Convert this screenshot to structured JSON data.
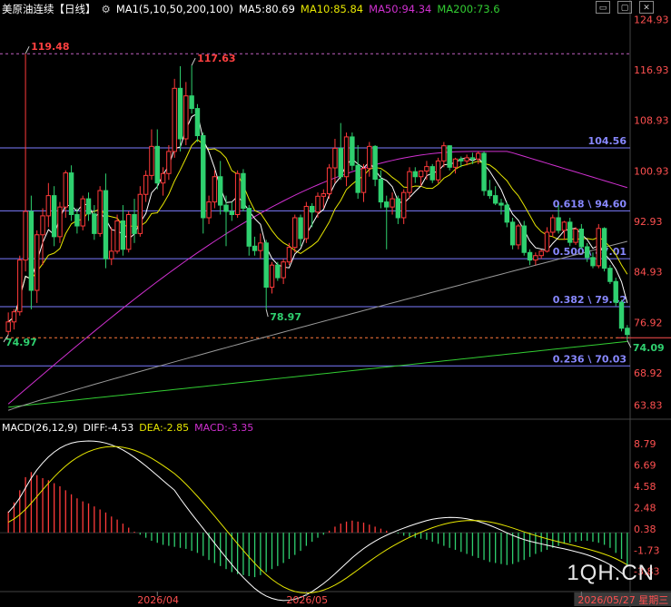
{
  "header": {
    "title": "美原油连续",
    "period": "【日线】",
    "ma_main": "MA1(5,10,50,200,100)",
    "ma5": "MA5:80.69",
    "ma10": "MA10:85.84",
    "ma50": "MA50:94.34",
    "ma200": "MA200:73.6"
  },
  "macd_header": {
    "params": "MACD(26,12,9)",
    "diff": "DIFF:-4.53",
    "dea": "DEA:-2.85",
    "macd": "MACD:-3.35"
  },
  "colors": {
    "up": "#ff3a3a",
    "down": "#2fd06f",
    "ma5": "#ffffff",
    "ma10": "#e6e600",
    "ma50": "#d030d0",
    "ma200": "#32cd32",
    "ma100": "#9a9a9a",
    "fib": "#7b7bff",
    "dashed": "#ff7a3c"
  },
  "watermark": "1QH.CN",
  "chart_data": {
    "type": "candlestick",
    "price_axis": {
      "min": 62.6,
      "max": 125.4,
      "ticks": [
        "124.93",
        "116.93",
        "108.93",
        "100.93",
        "92.93",
        "84.93",
        "76.92",
        "68.92",
        "63.83"
      ]
    },
    "fib_levels": [
      {
        "value": 104.56,
        "label": "104.56"
      },
      {
        "value": 94.6,
        "label": "0.618 \\ 94.60"
      },
      {
        "value": 87.01,
        "label": "0.500 \\ 87.01"
      },
      {
        "value": 79.42,
        "label": "0.382 \\ 79.42"
      },
      {
        "value": 70.03,
        "label": "0.236 \\ 70.03"
      }
    ],
    "dashed_levels": [
      {
        "value": 119.48
      },
      {
        "value": 74.5
      }
    ],
    "annotations": [
      {
        "label": "119.48",
        "value": 119.48,
        "index": 3,
        "color": "#ff4040"
      },
      {
        "label": "117.63",
        "value": 117.63,
        "index": 32,
        "color": "#ff4040"
      },
      {
        "label": "78.97",
        "value": 78.97,
        "index": 45,
        "color": "#2fd06f"
      },
      {
        "label": "74.97",
        "value": 74.97,
        "index": 0,
        "color": "#2fd06f"
      },
      {
        "label": "74.09",
        "value": 74.09,
        "index": 108,
        "color": "#2fd06f"
      }
    ],
    "candles": [
      [
        75.5,
        78.5,
        74.97,
        77.0
      ],
      [
        77.0,
        79.0,
        75.8,
        78.6
      ],
      [
        78.6,
        87.5,
        78.0,
        86.8
      ],
      [
        86.8,
        119.48,
        85.0,
        94.5
      ],
      [
        94.5,
        97.0,
        79.0,
        82.0
      ],
      [
        82.0,
        91.5,
        80.0,
        90.8
      ],
      [
        90.8,
        95.0,
        86.0,
        93.8
      ],
      [
        93.8,
        99.0,
        92.0,
        97.0
      ],
      [
        97.0,
        98.5,
        89.0,
        90.5
      ],
      [
        90.5,
        96.0,
        89.5,
        95.2
      ],
      [
        95.2,
        101.0,
        93.5,
        100.6
      ],
      [
        100.6,
        101.8,
        93.0,
        94.0
      ],
      [
        94.0,
        95.0,
        91.0,
        92.2
      ],
      [
        92.2,
        97.0,
        91.5,
        96.5
      ],
      [
        96.5,
        97.5,
        93.0,
        94.1
      ],
      [
        94.1,
        95.5,
        90.0,
        91.0
      ],
      [
        91.0,
        98.5,
        90.5,
        97.8
      ],
      [
        97.8,
        100.5,
        85.5,
        87.0
      ],
      [
        87.0,
        92.0,
        86.0,
        88.2
      ],
      [
        88.2,
        94.0,
        87.8,
        93.0
      ],
      [
        93.0,
        95.5,
        87.5,
        88.5
      ],
      [
        88.5,
        94.5,
        88.0,
        94.0
      ],
      [
        94.0,
        96.5,
        89.5,
        91.0
      ],
      [
        91.0,
        98.5,
        90.5,
        97.2
      ],
      [
        97.2,
        101.0,
        96.0,
        100.2
      ],
      [
        100.2,
        107.5,
        99.5,
        104.8
      ],
      [
        104.8,
        107.5,
        98.0,
        99.0
      ],
      [
        99.0,
        101.5,
        97.0,
        100.5
      ],
      [
        100.5,
        105.0,
        99.5,
        104.0
      ],
      [
        104.0,
        115.5,
        103.0,
        114.0
      ],
      [
        114.0,
        117.5,
        104.0,
        106.0
      ],
      [
        106.0,
        115.0,
        105.0,
        112.8
      ],
      [
        112.8,
        117.63,
        110.0,
        110.8
      ],
      [
        110.8,
        111.5,
        105.5,
        106.5
      ],
      [
        106.5,
        107.0,
        91.0,
        93.5
      ],
      [
        93.5,
        97.0,
        92.5,
        96.0
      ],
      [
        96.0,
        101.0,
        95.0,
        100.0
      ],
      [
        100.0,
        102.5,
        94.0,
        95.5
      ],
      [
        95.5,
        97.0,
        89.0,
        94.5
      ],
      [
        94.5,
        96.0,
        93.0,
        94.0
      ],
      [
        94.0,
        101.0,
        93.5,
        100.5
      ],
      [
        100.5,
        101.2,
        94.5,
        95.0
      ],
      [
        95.0,
        95.5,
        87.5,
        89.0
      ],
      [
        89.0,
        90.5,
        87.5,
        88.3
      ],
      [
        88.3,
        91.0,
        87.0,
        89.5
      ],
      [
        89.5,
        90.0,
        78.97,
        82.5
      ],
      [
        82.5,
        86.5,
        81.5,
        86.0
      ],
      [
        86.0,
        86.5,
        83.5,
        84.0
      ],
      [
        84.0,
        87.0,
        83.0,
        86.5
      ],
      [
        86.5,
        89.5,
        86.0,
        88.8
      ],
      [
        88.8,
        94.0,
        88.0,
        93.5
      ],
      [
        93.5,
        94.0,
        89.0,
        90.2
      ],
      [
        90.2,
        96.0,
        89.5,
        95.3
      ],
      [
        95.3,
        95.8,
        92.0,
        94.4
      ],
      [
        94.4,
        97.5,
        93.5,
        96.9
      ],
      [
        96.9,
        98.0,
        95.0,
        97.3
      ],
      [
        97.3,
        102.0,
        96.5,
        101.4
      ],
      [
        101.4,
        106.0,
        99.0,
        104.5
      ],
      [
        104.5,
        108.5,
        99.5,
        100.0
      ],
      [
        100.0,
        107.0,
        98.5,
        106.3
      ],
      [
        106.3,
        107.0,
        101.0,
        101.8
      ],
      [
        101.8,
        105.0,
        96.5,
        97.5
      ],
      [
        97.5,
        102.0,
        96.0,
        101.3
      ],
      [
        101.3,
        105.5,
        100.0,
        104.8
      ],
      [
        104.8,
        105.0,
        98.5,
        99.6
      ],
      [
        99.6,
        101.0,
        95.0,
        96.0
      ],
      [
        96.0,
        97.0,
        88.5,
        95.2
      ],
      [
        95.2,
        97.5,
        94.0,
        96.5
      ],
      [
        96.5,
        97.0,
        92.5,
        93.5
      ],
      [
        93.5,
        98.0,
        92.5,
        97.5
      ],
      [
        97.5,
        101.5,
        96.5,
        100.8
      ],
      [
        100.8,
        101.5,
        99.0,
        100.0
      ],
      [
        100.0,
        101.0,
        98.5,
        100.9
      ],
      [
        100.9,
        102.5,
        99.5,
        101.6
      ],
      [
        101.6,
        102.0,
        99.0,
        99.5
      ],
      [
        99.5,
        103.0,
        99.0,
        102.5
      ],
      [
        102.5,
        105.5,
        101.5,
        104.9
      ],
      [
        104.9,
        105.0,
        101.0,
        101.5
      ],
      [
        101.5,
        103.0,
        100.5,
        102.8
      ],
      [
        102.8,
        103.2,
        101.5,
        102.5
      ],
      [
        102.5,
        103.5,
        101.8,
        103.0
      ],
      [
        103.0,
        103.8,
        102.0,
        102.8
      ],
      [
        102.8,
        104.0,
        102.0,
        103.7
      ],
      [
        103.7,
        104.0,
        97.0,
        97.8
      ],
      [
        97.8,
        99.5,
        96.5,
        97.0
      ],
      [
        97.0,
        98.5,
        95.5,
        95.8
      ],
      [
        95.8,
        96.5,
        94.0,
        95.5
      ],
      [
        95.5,
        96.0,
        92.0,
        92.8
      ],
      [
        92.8,
        93.5,
        88.5,
        89.2
      ],
      [
        89.2,
        92.5,
        88.5,
        92.2
      ],
      [
        92.2,
        93.0,
        87.5,
        88.0
      ],
      [
        88.0,
        88.5,
        86.0,
        86.8
      ],
      [
        86.8,
        88.0,
        86.0,
        87.5
      ],
      [
        87.5,
        88.5,
        87.0,
        88.2
      ],
      [
        88.2,
        92.0,
        88.0,
        91.2
      ],
      [
        91.2,
        94.0,
        90.5,
        93.5
      ],
      [
        93.5,
        95.5,
        91.0,
        91.5
      ],
      [
        91.5,
        93.0,
        90.0,
        92.8
      ],
      [
        92.8,
        93.5,
        89.0,
        89.6
      ],
      [
        89.6,
        92.0,
        89.2,
        91.7
      ],
      [
        91.7,
        92.5,
        88.5,
        88.9
      ],
      [
        88.9,
        89.5,
        86.5,
        87.2
      ],
      [
        87.2,
        88.0,
        85.5,
        85.9
      ],
      [
        85.9,
        92.5,
        85.5,
        91.8
      ],
      [
        91.8,
        92.0,
        85.0,
        85.5
      ],
      [
        85.5,
        86.0,
        83.0,
        83.4
      ],
      [
        83.4,
        84.0,
        79.5,
        80.1
      ],
      [
        80.1,
        80.5,
        75.5,
        76.0
      ],
      [
        76.0,
        76.5,
        74.09,
        75.0
      ]
    ],
    "macd_axis": {
      "min": -5.2,
      "max": 9.8,
      "ticks": [
        "8.79",
        "6.69",
        "4.58",
        "2.48",
        "0.38",
        "-1.73",
        "-3.83"
      ]
    },
    "macd_hist": [
      2.1,
      3.0,
      4.2,
      5.5,
      6.0,
      5.7,
      5.4,
      5.2,
      4.9,
      4.6,
      4.2,
      3.8,
      3.4,
      3.1,
      2.9,
      2.6,
      2.3,
      2.0,
      1.6,
      1.3,
      0.9,
      0.5,
      0.1,
      -0.2,
      -0.5,
      -0.8,
      -1.0,
      -1.2,
      -1.3,
      -1.4,
      -1.5,
      -1.6,
      -1.8,
      -2.0,
      -2.3,
      -2.7,
      -3.0,
      -3.3,
      -3.6,
      -3.9,
      -4.1,
      -4.2,
      -4.3,
      -4.4,
      -4.2,
      -3.9,
      -3.6,
      -3.3,
      -3.0,
      -2.6,
      -2.2,
      -1.8,
      -1.3,
      -0.9,
      -0.5,
      -0.2,
      0.2,
      0.6,
      0.9,
      1.1,
      1.2,
      1.1,
      1.0,
      0.8,
      0.6,
      0.4,
      0.2,
      0.0,
      -0.1,
      -0.3,
      -0.4,
      -0.5,
      -0.6,
      -0.7,
      -0.9,
      -1.1,
      -1.3,
      -1.5,
      -1.7,
      -1.9,
      -2.1,
      -2.3,
      -2.5,
      -2.7,
      -2.9,
      -3.0,
      -3.1,
      -3.2,
      -3.1,
      -2.9,
      -2.7,
      -2.4,
      -2.1,
      -1.9,
      -1.7,
      -1.5,
      -1.3,
      -1.1,
      -1.0,
      -0.9,
      -0.8,
      -0.8,
      -0.9,
      -1.0,
      -1.2,
      -1.5,
      -2.0,
      -2.6,
      -3.35
    ],
    "x_labels": [
      {
        "label": "2026/04",
        "index": 26
      },
      {
        "label": "2026/05",
        "index": 52
      },
      {
        "label": "2026/05/27 星期三",
        "index": 100
      }
    ]
  }
}
